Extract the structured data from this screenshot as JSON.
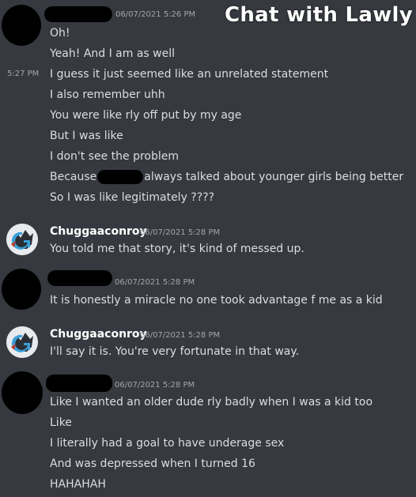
{
  "overlay_title": "Chat with Lawly",
  "messages": {
    "g1": {
      "timestamp": "06/07/2021 5:26 PM",
      "side_time": "5:27 PM",
      "lines": [
        "Oh!",
        "Yeah! And I am as well",
        "I guess it just seemed like an unrelated statement",
        "I also remember uhh",
        "You were like rly off put by my age",
        "But I was like",
        "I don't see the problem"
      ],
      "because_prefix": "Because",
      "because_suffix": "always talked about younger girls being better",
      "last_line": "So I was like legitimately ????"
    },
    "g2": {
      "username": "Chuggaaconroy",
      "timestamp": "06/07/2021 5:28 PM",
      "lines": [
        "You told me that story, it's kind of messed up."
      ]
    },
    "g3": {
      "timestamp": "06/07/2021 5:28 PM",
      "lines": [
        "It is honestly a miracle no one took advantage f me as a kid"
      ]
    },
    "g4": {
      "username": "Chuggaaconroy",
      "timestamp": "06/07/2021 5:28 PM",
      "lines": [
        "I'll say it is. You're very fortunate in that way."
      ]
    },
    "g5": {
      "timestamp": "06/07/2021 5:28 PM",
      "lines": [
        "Like I wanted an older dude rly badly when I was a kid too",
        "Like",
        "I literally had a goal to have underage sex",
        "And was depressed when I turned 16",
        "HAHAHAH"
      ]
    }
  }
}
